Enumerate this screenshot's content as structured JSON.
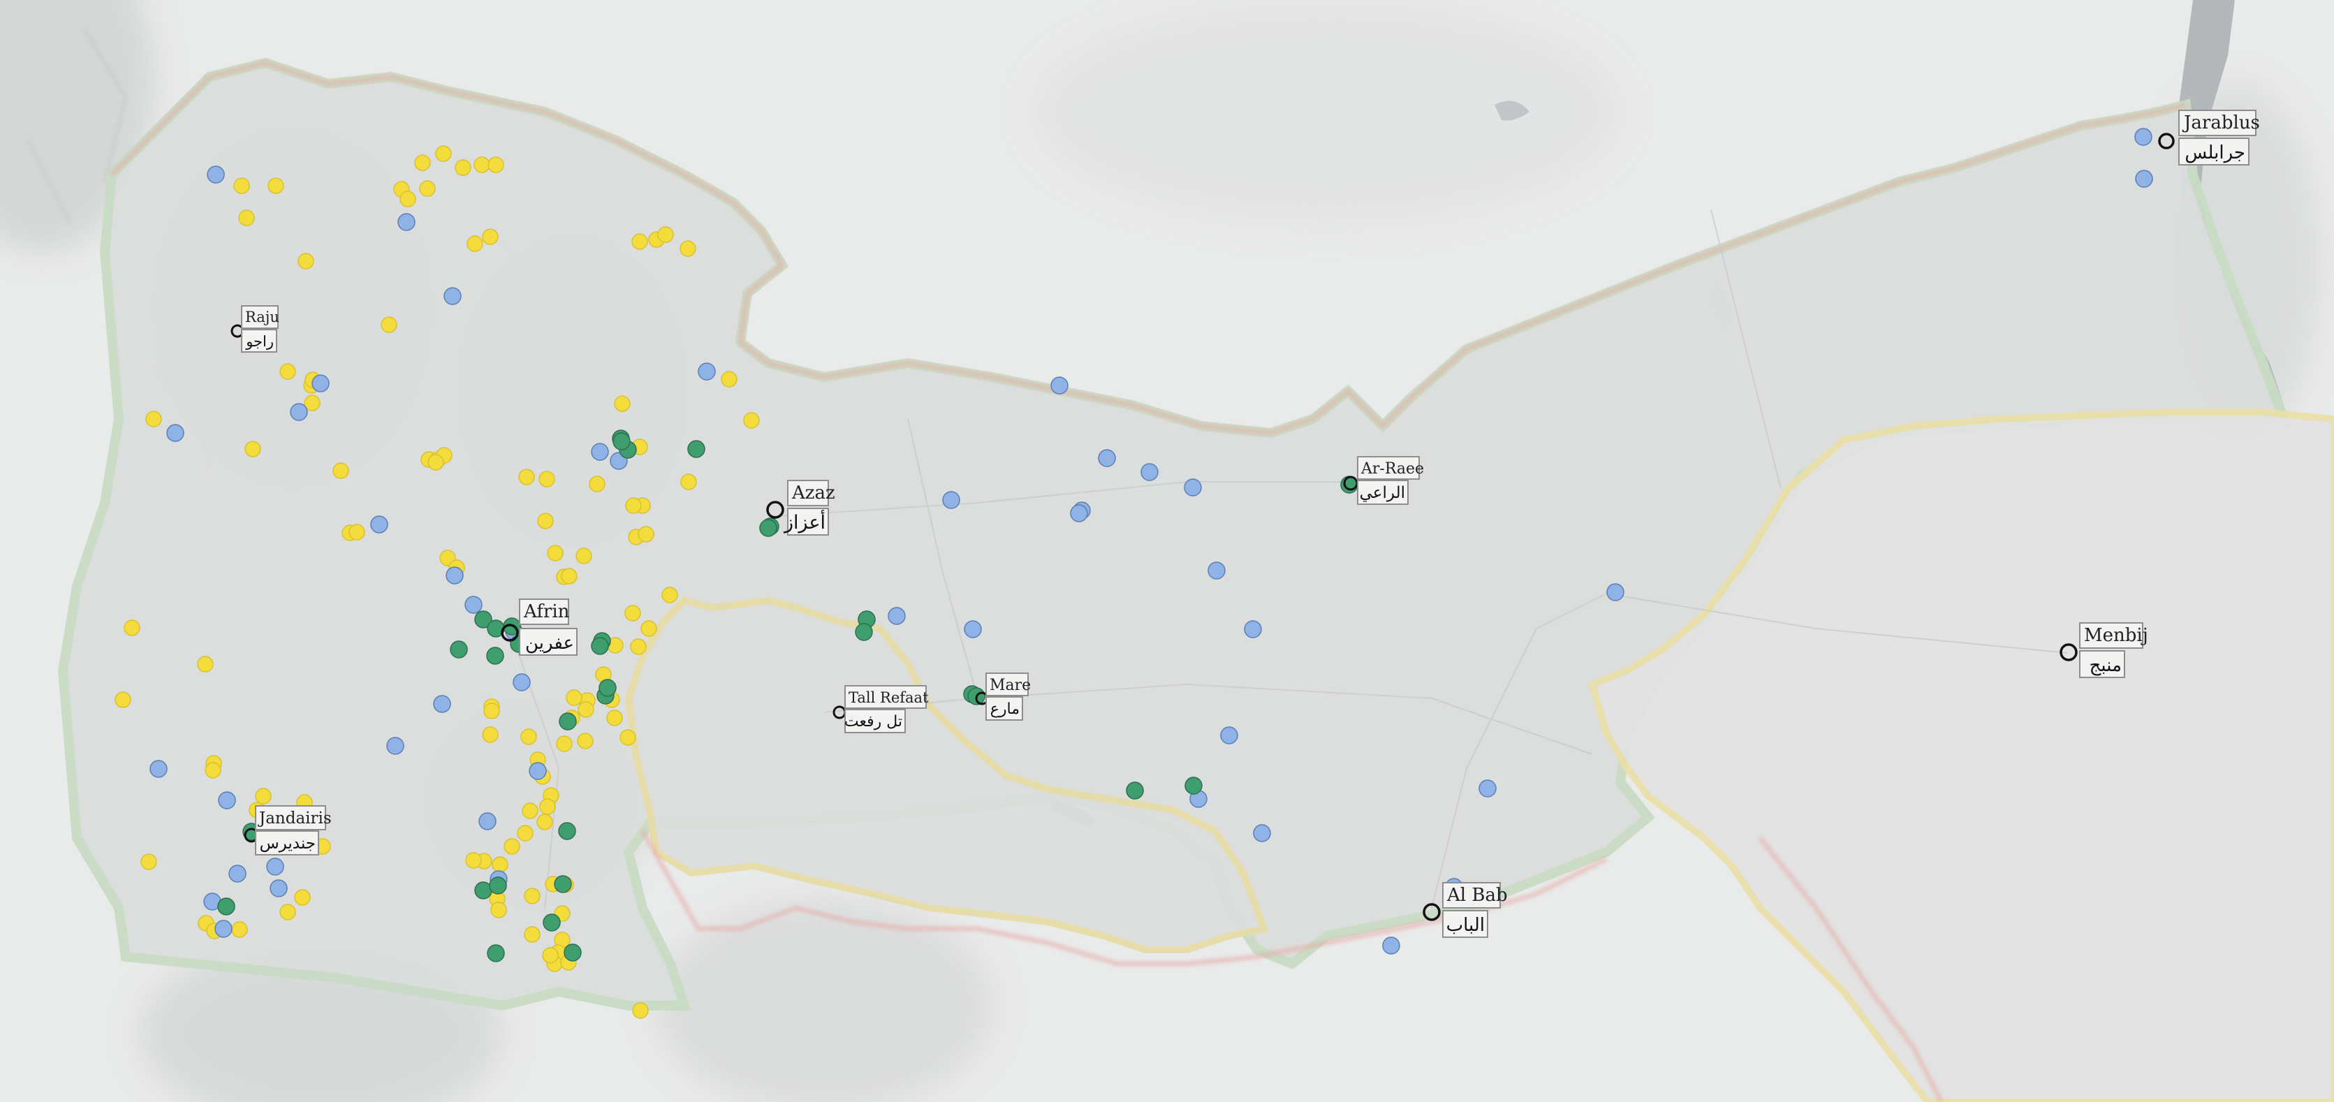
{
  "colors": {
    "background": "#e9eaea",
    "relief_dark": "#b9bcbc",
    "region_fill": "#d6d8d7",
    "border_red": "#e9a9a4",
    "border_yellow": "#e8dc9c",
    "border_green": "#cfe3c9",
    "water": "#a9aeb0",
    "point_blue": "#8fb3e6",
    "point_yellow": "#f3dc3c",
    "point_green": "#3f9e6e",
    "town_marker": "#111111",
    "label_box": "#f3f3f1"
  },
  "towns": [
    {
      "id": "jarablus",
      "name_en": "Jarablus",
      "name_ar": "جرابلس"
    },
    {
      "id": "azaz",
      "name_en": "Azaz",
      "name_ar": "أعزاز"
    },
    {
      "id": "ar-raee",
      "name_en": "Ar-Raee",
      "name_ar": "الراعي"
    },
    {
      "id": "raju",
      "name_en": "Raju",
      "name_ar": "راجو"
    },
    {
      "id": "afrin",
      "name_en": "Afrin",
      "name_ar": "عفرين"
    },
    {
      "id": "tall-refaat",
      "name_en": "Tall Refaat",
      "name_ar": "تل رفعت"
    },
    {
      "id": "mare",
      "name_en": "Mare",
      "name_ar": "مارع"
    },
    {
      "id": "menbij",
      "name_en": "Menbij",
      "name_ar": "منبج"
    },
    {
      "id": "jandairis",
      "name_en": "Jandairis",
      "name_ar": "جنديرس"
    },
    {
      "id": "al-bab",
      "name_en": "Al Bab",
      "name_ar": "الباب"
    }
  ]
}
